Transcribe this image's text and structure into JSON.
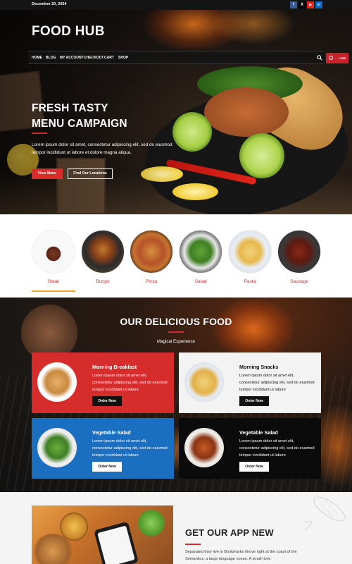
{
  "topbar": {
    "date": "December 20, 2024",
    "social": [
      {
        "icon": "facebook-icon",
        "glyph": "f",
        "color": "#3b5998"
      },
      {
        "icon": "x-icon",
        "glyph": "X",
        "color": "#000000"
      },
      {
        "icon": "youtube-icon",
        "glyph": "▶",
        "color": "#e02a20"
      },
      {
        "icon": "linkedin-icon",
        "glyph": "in",
        "color": "#0a66c2"
      }
    ]
  },
  "brand": {
    "logo": "FOOD HUB"
  },
  "nav": {
    "items": [
      "HOME",
      "BLOG",
      "MY ACCOUNT",
      "CHECKOUT",
      "CART",
      "SHOP"
    ],
    "live": "LIVE"
  },
  "hero": {
    "title_line1": "FRESH TASTY",
    "title_line2": "MENU CAMPAIGN",
    "text": "Lorem ipsum dolor sit amet, consectetur adipiscing elit, sed do eiusmod tempor incididunt ut labore et dolore magna aliqua.",
    "btn_primary": "View Menu",
    "btn_secondary": "Find Our Locations"
  },
  "categories": [
    {
      "label": "Steak",
      "active": true
    },
    {
      "label": "Burger"
    },
    {
      "label": "Pizza"
    },
    {
      "label": "Salad"
    },
    {
      "label": "Pasta"
    },
    {
      "label": "Sausage"
    }
  ],
  "food_section": {
    "title": "OUR DELICIOUS FOOD",
    "subtitle": "Magical Experience",
    "cards": [
      {
        "title": "Morning Breakfast",
        "text": "Lorem ipsum dolor sit amet elit, consectetur adipiscing elit, sed do eiusmod tempor incididunt ut labore",
        "button": "Order Now",
        "bg": "#d62c2c"
      },
      {
        "title": "Morning Snacks",
        "text": "Lorem ipsum dolor sit amet elit, consectetur adipiscing elit, sed do eiusmod tempor incididunt ut labore",
        "button": "Order Now",
        "bg": "#f3f3f3"
      },
      {
        "title": "Vegetable Salad",
        "text": "Lorem ipsum dolor sit amet elit, consectetur adipiscing elit, sed do eiusmod tempor incididunt ut labore",
        "button": "Order Now",
        "bg": "#1a6fc1"
      },
      {
        "title": "Vegetable Salad",
        "text": "Lorem ipsum dolor sit amet elit, consectetur adipiscing elit, sed do eiusmod tempor incididunt ut labore",
        "button": "Order Now",
        "bg": "#0b0b0b"
      }
    ]
  },
  "app_section": {
    "title": "GET OUR APP NEW",
    "text": "Separated they live in Bookmarks Grove right at the coast of the Semantics, a large language ocean. A small river."
  },
  "colors": {
    "accent": "#d62c2c",
    "underline": "#f0a21c"
  }
}
